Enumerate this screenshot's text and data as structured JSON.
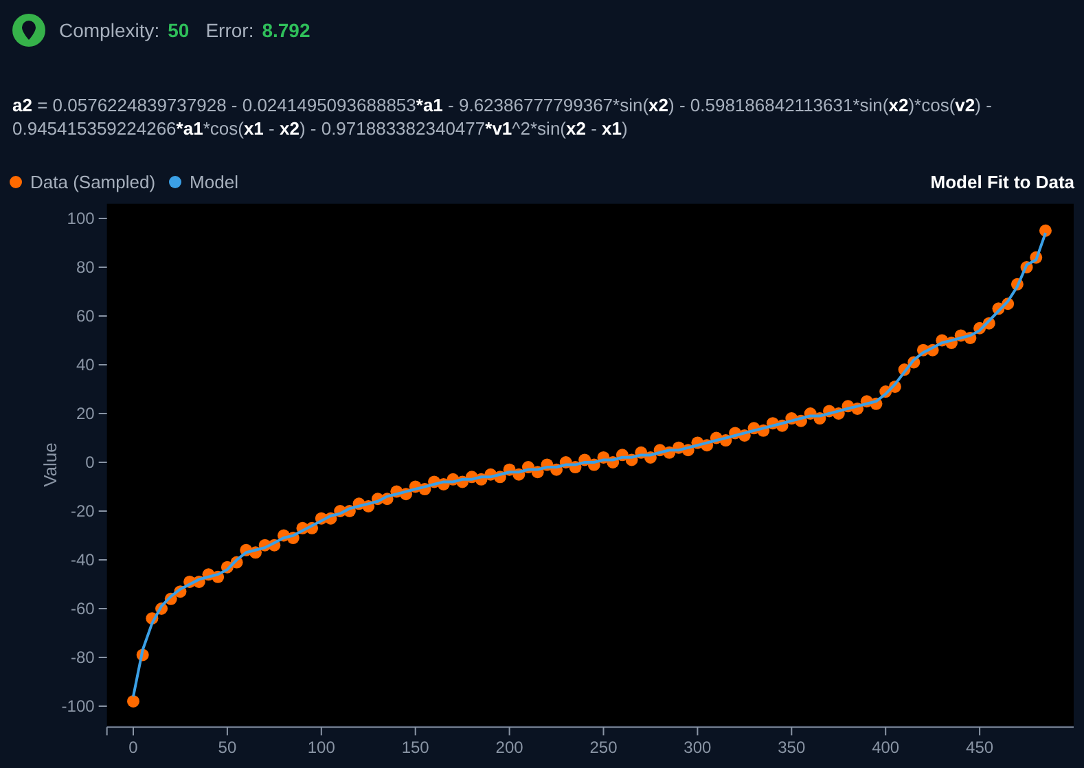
{
  "header": {
    "complexity_label": "Complexity:",
    "complexity": "50",
    "error_label": "Error:",
    "error": "8.792"
  },
  "formula": "**a2** = 0.0576224839737928 - 0.0241495093688853***a1** - 9.62386777799367*sin(**x2**) - 0.598186842113631*sin(**x2**)*cos(**v2**) - 0.945415359224266***a1***cos(**x1** - **x2**) - 0.971883382340477***v1**^2*sin(**x2** - **x1**)",
  "chart": {
    "title": "Model Fit to Data",
    "chart_data": {
      "type": "scatter",
      "ylabel": "Value",
      "xlim": [
        -14,
        500
      ],
      "ylim": [
        -108,
        106
      ],
      "xticks": [
        0,
        50,
        100,
        150,
        200,
        250,
        300,
        350,
        400,
        450
      ],
      "yticks": [
        -100,
        -80,
        -60,
        -40,
        -20,
        0,
        20,
        40,
        60,
        80,
        100
      ],
      "x": [
        0,
        5,
        10,
        15,
        20,
        25,
        30,
        35,
        40,
        45,
        50,
        55,
        60,
        65,
        70,
        75,
        80,
        85,
        90,
        95,
        100,
        105,
        110,
        115,
        120,
        125,
        130,
        135,
        140,
        145,
        150,
        155,
        160,
        165,
        170,
        175,
        180,
        185,
        190,
        195,
        200,
        205,
        210,
        215,
        220,
        225,
        230,
        235,
        240,
        245,
        250,
        255,
        260,
        265,
        270,
        275,
        280,
        285,
        290,
        295,
        300,
        305,
        310,
        315,
        320,
        325,
        330,
        335,
        340,
        345,
        350,
        355,
        360,
        365,
        370,
        375,
        380,
        385,
        390,
        395,
        400,
        405,
        410,
        415,
        420,
        425,
        430,
        435,
        440,
        445,
        450,
        455,
        460,
        465,
        470,
        475,
        480,
        485
      ],
      "series": [
        {
          "name": "Data (Sampled)",
          "type": "scatter",
          "color": "#ff6a00",
          "values": [
            -98,
            -79,
            -64,
            -60,
            -56,
            -53,
            -49,
            -49,
            -46,
            -47,
            -43,
            -41,
            -36,
            -37,
            -34,
            -34,
            -30,
            -31,
            -27,
            -27,
            -23,
            -23,
            -20,
            -20,
            -17,
            -18,
            -15,
            -15,
            -12,
            -13,
            -10,
            -11,
            -8,
            -9,
            -7,
            -8,
            -6,
            -7,
            -5,
            -6,
            -3,
            -5,
            -2,
            -4,
            -1,
            -3,
            0,
            -2,
            1,
            -1,
            2,
            0,
            3,
            1,
            4,
            2,
            5,
            4,
            6,
            5,
            8,
            7,
            10,
            9,
            12,
            11,
            14,
            13,
            16,
            15,
            18,
            17,
            20,
            18,
            21,
            20,
            23,
            22,
            25,
            24,
            29,
            31,
            38,
            41,
            46,
            46,
            50,
            49,
            52,
            51,
            55,
            57,
            63,
            65,
            73,
            80,
            84,
            95
          ]
        },
        {
          "name": "Model",
          "type": "line",
          "color": "#3ba0e6",
          "values": [
            -96,
            -77,
            -66,
            -59,
            -55,
            -52,
            -50,
            -48,
            -47,
            -46,
            -44,
            -40,
            -37,
            -36,
            -35,
            -33,
            -31,
            -30,
            -28,
            -26,
            -24,
            -22,
            -21,
            -19,
            -18,
            -17,
            -16,
            -14,
            -13,
            -12,
            -11,
            -10,
            -9,
            -8,
            -8,
            -7,
            -7,
            -6,
            -6,
            -5,
            -4,
            -4,
            -3,
            -3,
            -2,
            -2,
            -1,
            -1,
            0,
            0,
            1,
            1,
            2,
            2,
            3,
            3,
            4,
            5,
            5,
            6,
            7,
            8,
            9,
            10,
            11,
            12,
            13,
            14,
            15,
            16,
            17,
            18,
            19,
            19,
            20,
            21,
            22,
            23,
            24,
            25,
            28,
            32,
            37,
            42,
            45,
            47,
            49,
            50,
            51,
            52,
            54,
            58,
            62,
            66,
            72,
            81,
            83,
            94
          ]
        }
      ]
    }
  }
}
